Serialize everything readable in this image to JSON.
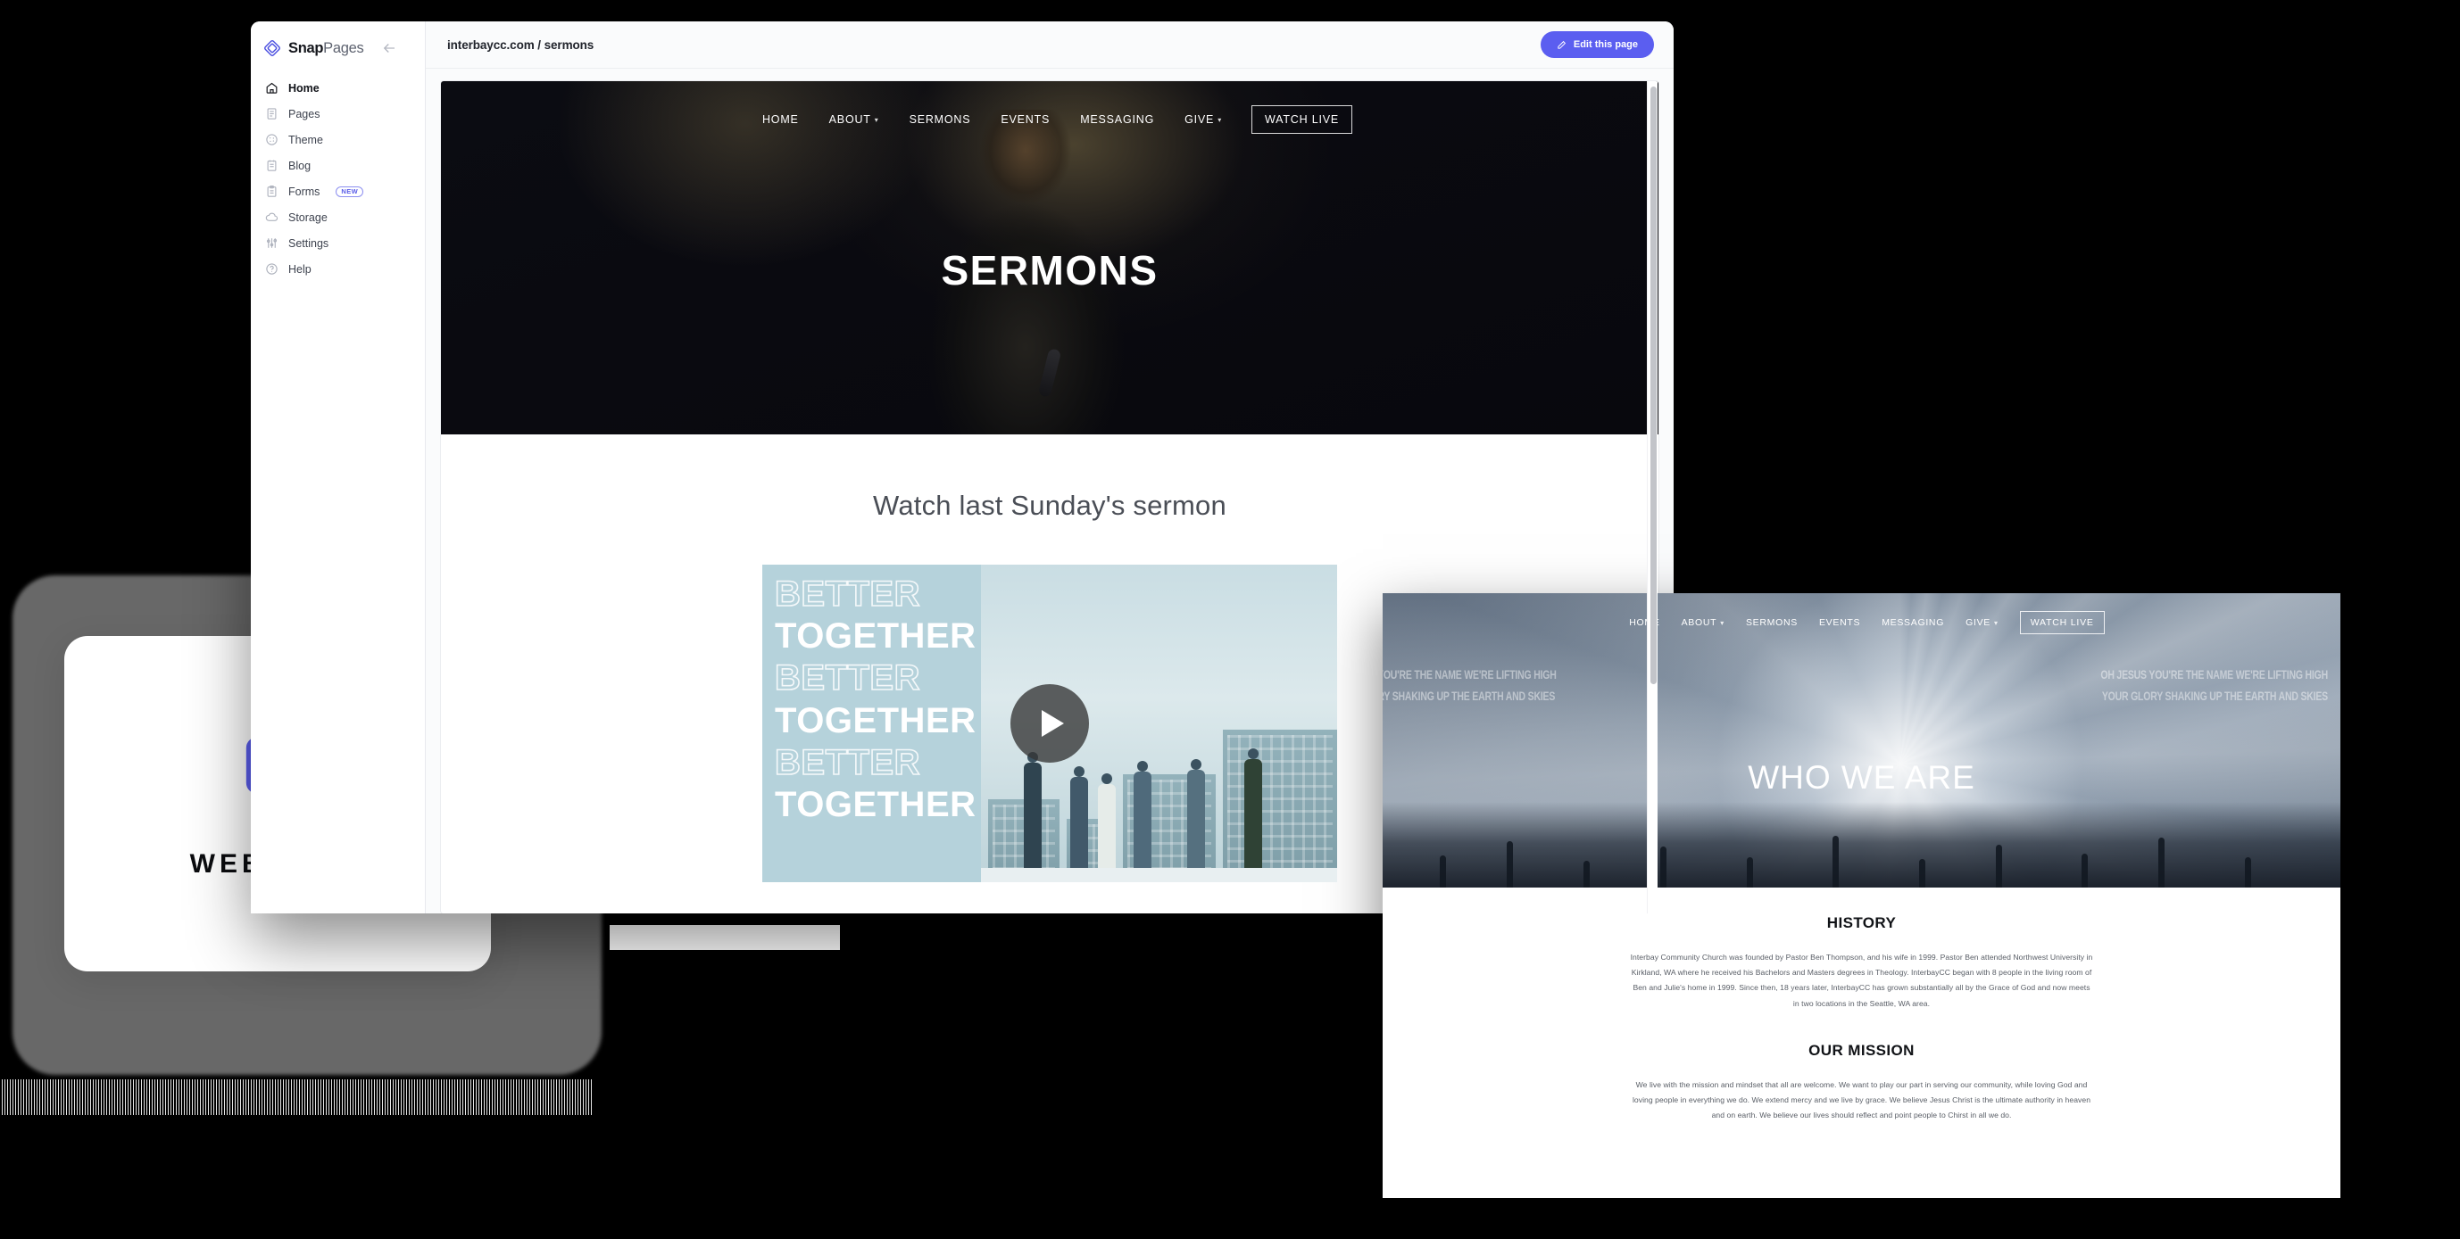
{
  "app": {
    "brand": {
      "bold": "Snap",
      "light": "Pages",
      "logo_icon": "snappages-diamond-logo",
      "collapse_icon": "arrow-left-icon"
    },
    "sidebar": {
      "items": [
        {
          "label": "Home",
          "icon": "home-icon",
          "active": true
        },
        {
          "label": "Pages",
          "icon": "document-icon",
          "active": false
        },
        {
          "label": "Theme",
          "icon": "palette-icon",
          "active": false
        },
        {
          "label": "Blog",
          "icon": "notebook-icon",
          "active": false
        },
        {
          "label": "Forms",
          "icon": "clipboard-icon",
          "active": false,
          "badge": "NEW"
        },
        {
          "label": "Storage",
          "icon": "cloud-icon",
          "active": false
        },
        {
          "label": "Settings",
          "icon": "sliders-icon",
          "active": false
        },
        {
          "label": "Help",
          "icon": "question-circle-icon",
          "active": false
        }
      ]
    },
    "topbar": {
      "breadcrumb": "interbaycc.com / sermons",
      "edit_button": "Edit this page",
      "edit_icon": "pencil-icon"
    }
  },
  "site_preview": {
    "nav": [
      {
        "label": "HOME",
        "caret": false
      },
      {
        "label": "ABOUT",
        "caret": true
      },
      {
        "label": "SERMONS",
        "caret": false
      },
      {
        "label": "EVENTS",
        "caret": false
      },
      {
        "label": "MESSAGING",
        "caret": false
      },
      {
        "label": "GIVE",
        "caret": true
      }
    ],
    "cta": "WATCH LIVE",
    "hero_title": "SERMONS",
    "section_title": "Watch last Sunday's sermon",
    "video": {
      "lines": [
        "BETTER",
        "TOGETHER",
        "BETTER",
        "TOGETHER",
        "BETTER",
        "TOGETHER"
      ],
      "play_icon": "play-button-icon"
    }
  },
  "site_window2": {
    "nav": [
      {
        "label": "HOME",
        "caret": false
      },
      {
        "label": "ABOUT",
        "caret": true
      },
      {
        "label": "SERMONS",
        "caret": false
      },
      {
        "label": "EVENTS",
        "caret": false
      },
      {
        "label": "MESSAGING",
        "caret": false
      },
      {
        "label": "GIVE",
        "caret": true
      }
    ],
    "cta": "WATCH LIVE",
    "hero_title": "WHO WE ARE",
    "background_lyrics_left": "OH JESUS YOU'RE THE NAME WE'RE LIFTING HIGH\nYOUR GLORY SHAKING UP THE EARTH AND SKIES",
    "background_lyrics_right": "OH JESUS YOU'RE THE NAME WE'RE LIFTING HIGH\nYOUR GLORY SHAKING UP THE EARTH AND SKIES",
    "history": {
      "heading": "HISTORY",
      "body": "Interbay Community Church was founded by Pastor Ben Thompson, and his wife in 1999. Pastor Ben attended Northwest University in Kirkland, WA where he received his Bachelors and Masters degrees in Theology. InterbayCC began with 8 people in the living room of Ben and Julie's home in 1999. Since then, 18 years later, InterbayCC has grown substantially all by the Grace of God and now meets in two locations in the Seattle, WA area."
    },
    "mission": {
      "heading": "OUR MISSION",
      "body": "We live with the mission and mindset that all are welcome. We want to play our part in serving our community, while loving God and loving people in everything we do. We extend mercy and we live by grace. We believe Jesus Christ is the ultimate authority in heaven and on earth. We believe our lives should reflect and point people to Chirst in all we do."
    }
  },
  "websites_card": {
    "label": "WEBSITES",
    "icon": "browser-window-icon"
  },
  "colors": {
    "accent": "#5b5ef0",
    "badge_border": "#8c8ef0",
    "sidebar_text": "#3d424e",
    "breadcrumb": "#21242c"
  }
}
